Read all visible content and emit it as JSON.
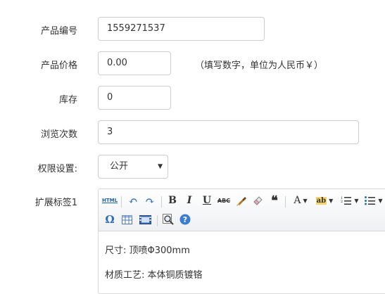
{
  "form": {
    "product_code": {
      "label": "产品编号",
      "value": "1559271537"
    },
    "price": {
      "label": "产品价格",
      "value": "0.00",
      "hint": "（填写数字，单位为人民币￥）"
    },
    "stock": {
      "label": "库存",
      "value": "0"
    },
    "views": {
      "label": "浏览次数",
      "value": "3"
    },
    "permission": {
      "label": "权限设置:",
      "selected": "公开"
    },
    "ext_tag": {
      "label": "扩展标签1"
    }
  },
  "editor": {
    "toolbar": {
      "html": "HTML",
      "bold": "B",
      "italic": "I",
      "underline": "U",
      "strike": "ABC",
      "font": "A",
      "bg_color": "ab",
      "special_char": "Ω"
    },
    "content": [
      "尺寸: 顶喷Φ300mm",
      "材质工艺: 本体铜质镀铬"
    ]
  }
}
